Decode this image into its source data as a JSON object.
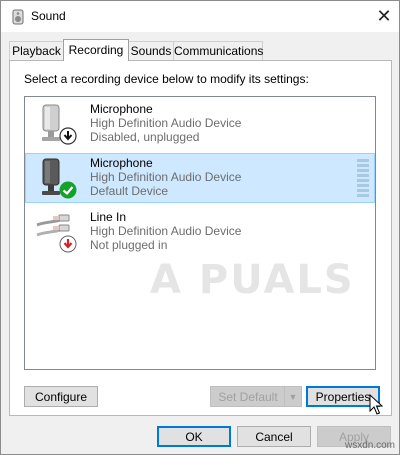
{
  "window": {
    "title": "Sound",
    "title_icon": "speaker-icon",
    "close_glyph": "✕"
  },
  "tabs": [
    {
      "label": "Playback",
      "active": false
    },
    {
      "label": "Recording",
      "active": true
    },
    {
      "label": "Sounds",
      "active": false
    },
    {
      "label": "Communications",
      "active": false
    }
  ],
  "panel": {
    "instruction": "Select a recording device below to modify its settings:"
  },
  "devices": [
    {
      "name": "Microphone",
      "driver": "High Definition Audio Device",
      "status": "Disabled, unplugged",
      "icon": "microphone-icon",
      "badge": "down-arrow-badge-icon",
      "selected": false
    },
    {
      "name": "Microphone",
      "driver": "High Definition Audio Device",
      "status": "Default Device",
      "icon": "microphone-icon",
      "badge": "green-check-badge-icon",
      "selected": true
    },
    {
      "name": "Line In",
      "driver": "High Definition Audio Device",
      "status": "Not plugged in",
      "icon": "line-in-jack-icon",
      "badge": "red-down-arrow-badge-icon",
      "selected": false
    }
  ],
  "watermark": "A PUALS",
  "buttons": {
    "configure": "Configure",
    "set_default": "Set Default",
    "properties": "Properties",
    "ok": "OK",
    "cancel": "Cancel",
    "apply": "Apply"
  },
  "footer_watermark": "wsxdn.com",
  "colors": {
    "selection": "#cde8ff",
    "focus_border": "#0078d7",
    "check_green": "#16a22a",
    "arrow_red": "#d9202a"
  }
}
